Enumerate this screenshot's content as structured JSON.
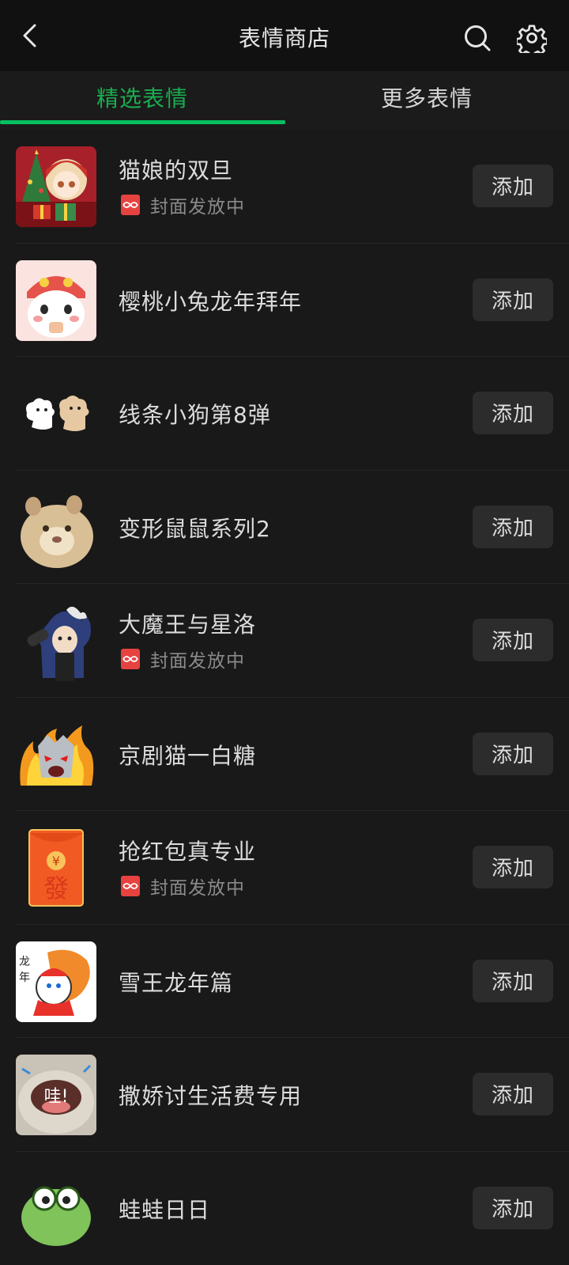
{
  "header": {
    "title": "表情商店",
    "back_icon": "chevron-left-icon",
    "search_icon": "search-icon",
    "settings_icon": "gear-icon"
  },
  "tabs": [
    {
      "label": "精选表情",
      "active": true
    },
    {
      "label": "更多表情",
      "active": false
    }
  ],
  "colors": {
    "accent": "#07c160",
    "background": "#191919",
    "button_bg": "#2c2c2c",
    "badge_red": "#e64340"
  },
  "items": [
    {
      "name": "猫娘的双旦",
      "subtitle": "封面发放中",
      "button": "添加"
    },
    {
      "name": "樱桃小兔龙年拜年",
      "button": "添加"
    },
    {
      "name": "线条小狗第8弹",
      "button": "添加"
    },
    {
      "name": "变形鼠鼠系列2",
      "button": "添加"
    },
    {
      "name": "大魔王与星洛",
      "subtitle": "封面发放中",
      "button": "添加"
    },
    {
      "name": "京剧猫一白糖",
      "button": "添加"
    },
    {
      "name": "抢红包真专业",
      "subtitle": "封面发放中",
      "button": "添加",
      "thumb_text": "¥ 發"
    },
    {
      "name": "雪王龙年篇",
      "button": "添加"
    },
    {
      "name": "撒娇讨生活费专用",
      "button": "添加",
      "thumb_text": "哇!"
    },
    {
      "name": "蛙蛙日日",
      "button": "添加"
    }
  ]
}
